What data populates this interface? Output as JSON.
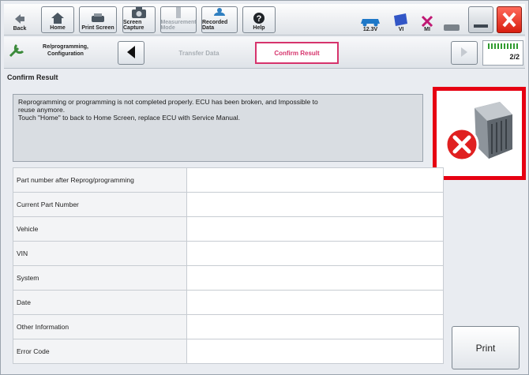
{
  "toolbar": {
    "back_label": "Back",
    "home_label": "Home",
    "print_screen_label": "Print Screen",
    "screen_capture_label": "Screen Capture",
    "measurement_mode_label": "Measurement Mode",
    "recorded_data_label": "Recorded Data",
    "help_label": "Help",
    "voltage": "12.3V",
    "vi_label": "VI",
    "mi_label": "MI"
  },
  "nav": {
    "section_label": "Re/programming, Configuration",
    "step_transfer": "Transfer Data",
    "step_confirm": "Confirm Result",
    "page_indicator": "2/2"
  },
  "page": {
    "title": "Confirm Result",
    "message_line1": "Reprogramming or programming is not completed properly. ECU has been broken, and Impossible to",
    "message_line2": "reuse anymore.",
    "message_line3": "Touch \"Home\" to back to Home Screen, replace ECU with Service Manual."
  },
  "table": {
    "rows": [
      {
        "label": "Part number after Reprog/programming",
        "value": ""
      },
      {
        "label": "Current Part Number",
        "value": ""
      },
      {
        "label": "Vehicle",
        "value": ""
      },
      {
        "label": "VIN",
        "value": ""
      },
      {
        "label": "System",
        "value": ""
      },
      {
        "label": "Date",
        "value": ""
      },
      {
        "label": "Other Information",
        "value": ""
      },
      {
        "label": "Error Code",
        "value": ""
      }
    ]
  },
  "print_button": "Print",
  "colors": {
    "highlight": "#e60012",
    "active_tab": "#d6336c",
    "error": "#e02020"
  }
}
